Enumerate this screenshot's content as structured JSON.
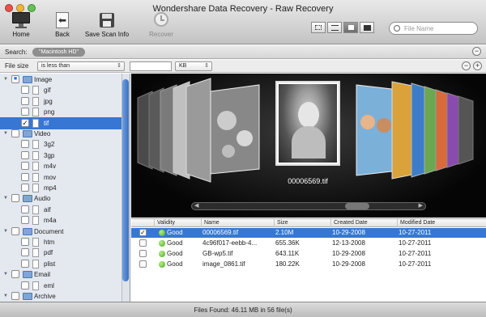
{
  "window": {
    "title": "Wondershare Data Recovery - Raw Recovery"
  },
  "toolbar": {
    "home_label": "Home",
    "back_label": "Back",
    "save_scan_label": "Save Scan Info",
    "recover_label": "Recover"
  },
  "search": {
    "placeholder": "File Name"
  },
  "searchbar": {
    "label": "Search:",
    "scope": "\"Macintosh HD\""
  },
  "filter": {
    "field": "File size",
    "operator": "is less than",
    "value": "",
    "unit": "KB"
  },
  "tree": [
    {
      "label": "Image",
      "type": "folder",
      "expanded": true,
      "checked": "partial"
    },
    {
      "label": "gif",
      "type": "file",
      "checked": false
    },
    {
      "label": "jpg",
      "type": "file",
      "checked": false
    },
    {
      "label": "png",
      "type": "file",
      "checked": false
    },
    {
      "label": "tif",
      "type": "file",
      "checked": true,
      "selected": true
    },
    {
      "label": "Video",
      "type": "folder",
      "expanded": true,
      "checked": false
    },
    {
      "label": "3g2",
      "type": "file",
      "checked": false
    },
    {
      "label": "3gp",
      "type": "file",
      "checked": false
    },
    {
      "label": "m4v",
      "type": "file",
      "checked": false
    },
    {
      "label": "mov",
      "type": "file",
      "checked": false
    },
    {
      "label": "mp4",
      "type": "file",
      "checked": false
    },
    {
      "label": "Audio",
      "type": "folder",
      "expanded": true,
      "checked": false
    },
    {
      "label": "aif",
      "type": "file",
      "checked": false
    },
    {
      "label": "m4a",
      "type": "file",
      "checked": false
    },
    {
      "label": "Document",
      "type": "folder",
      "expanded": true,
      "checked": false
    },
    {
      "label": "htm",
      "type": "file",
      "checked": false
    },
    {
      "label": "pdf",
      "type": "file",
      "checked": false
    },
    {
      "label": "plist",
      "type": "file",
      "checked": false
    },
    {
      "label": "Email",
      "type": "folder",
      "expanded": true,
      "checked": false
    },
    {
      "label": "eml",
      "type": "file",
      "checked": false
    },
    {
      "label": "Archive",
      "type": "folder",
      "expanded": true,
      "checked": false
    }
  ],
  "preview": {
    "focused_name": "00006569.tif"
  },
  "table": {
    "columns": [
      "Validity",
      "Name",
      "Size",
      "Created Date",
      "Modified Date"
    ],
    "rows": [
      {
        "checked": true,
        "validity": "Good",
        "name": "00006569.tif",
        "size": "2.10M",
        "created": "10-29-2008",
        "modified": "10-27-2011",
        "selected": true
      },
      {
        "checked": false,
        "validity": "Good",
        "name": "4c96f017-eebb-4...",
        "size": "655.36K",
        "created": "12-13-2008",
        "modified": "10-27-2011"
      },
      {
        "checked": false,
        "validity": "Good",
        "name": "GB-wp5.tif",
        "size": "643.11K",
        "created": "10-29-2008",
        "modified": "10-27-2011"
      },
      {
        "checked": false,
        "validity": "Good",
        "name": "image_0861.tif",
        "size": "180.22K",
        "created": "10-29-2008",
        "modified": "10-27-2011"
      }
    ]
  },
  "status": {
    "text": "Files Found: 46.11 MB in  56 file(s)"
  },
  "colors": {
    "selection": "#3876d4",
    "good": "#4aa81e"
  }
}
